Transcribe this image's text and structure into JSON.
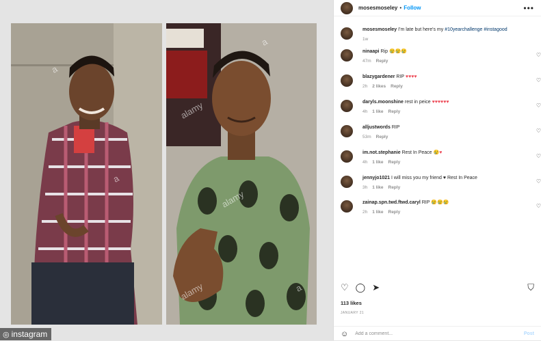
{
  "credit": "instagram",
  "watermarks": [
    "alamy",
    "alamy",
    "alamy",
    "a",
    "a",
    "a",
    "a"
  ],
  "header": {
    "username": "mosesmoseley",
    "follow": "Follow",
    "more": "•••"
  },
  "caption": {
    "username": "mosesmoseley",
    "text_prefix": "I'm late but here's my ",
    "hashtags": "#10yearchallenge #instagood",
    "age": "1w"
  },
  "comments": [
    {
      "username": "ninaapi",
      "text": "Rip",
      "emoji": "😢😢😢",
      "emoji_color": "yellow",
      "age": "47m",
      "likes": "",
      "reply": "Reply"
    },
    {
      "username": "blazygardener",
      "text": "RIP",
      "emoji": "♥♥♥♥",
      "emoji_color": "red",
      "age": "2h",
      "likes": "2 likes",
      "reply": "Reply"
    },
    {
      "username": "daryls.moonshine",
      "text": "rest in peice",
      "emoji": "♥♥♥♥♥♥",
      "emoji_color": "red",
      "age": "4h",
      "likes": "1 like",
      "reply": "Reply"
    },
    {
      "username": "alljustwords",
      "text": "RIP",
      "emoji": "",
      "emoji_color": "red",
      "age": "53m",
      "likes": "",
      "reply": "Reply"
    },
    {
      "username": "im.not.stephanie",
      "text": "Rest In Peace",
      "emoji": "😢♥",
      "emoji_color": "red",
      "age": "4h",
      "likes": "1 like",
      "reply": "Reply"
    },
    {
      "username": "jennyjo1021",
      "text": "I will miss you my friend ♥ Rest In Peace",
      "emoji": "",
      "emoji_color": "red",
      "age": "3h",
      "likes": "1 like",
      "reply": "Reply"
    },
    {
      "username": "zainap.spn.twd.ftwd.caryl",
      "text": "RIP",
      "emoji": "😢😢😢",
      "emoji_color": "yellow",
      "age": "2h",
      "likes": "1 like",
      "reply": "Reply"
    }
  ],
  "likes": "113 likes",
  "date": "JANUARY 21",
  "add_comment": {
    "placeholder": "Add a comment...",
    "post": "Post"
  },
  "icons": {
    "like": "heart-outline-icon",
    "comment": "speech-bubble-icon",
    "share": "paper-plane-icon",
    "save": "bookmark-icon",
    "emoji": "smiley-icon"
  },
  "colors": {
    "follow": "#0095f6",
    "heart": "#ed4956",
    "meta": "#8e8e8e",
    "text": "#262626"
  }
}
